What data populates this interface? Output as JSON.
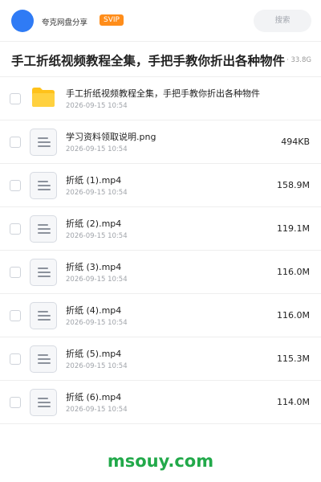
{
  "header": {
    "owner_name": "夸克网盘分享",
    "badge": "SVIP",
    "search_placeholder": "搜索"
  },
  "share": {
    "title": "手工折纸视频教程全集，手把手教你折出各种物件",
    "meta": "项 · 33.8G"
  },
  "files": [
    {
      "type": "folder",
      "name": "手工折纸视频教程全集，手把手教你折出各种物件",
      "date": "2026-09-15 10:54",
      "size": ""
    },
    {
      "type": "file",
      "name": "学习资料领取说明.png",
      "date": "2026-09-15 10:54",
      "size": "494KB"
    },
    {
      "type": "file",
      "name": "折纸 (1).mp4",
      "date": "2026-09-15 10:54",
      "size": "158.9M"
    },
    {
      "type": "file",
      "name": "折纸 (2).mp4",
      "date": "2026-09-15 10:54",
      "size": "119.1M"
    },
    {
      "type": "file",
      "name": "折纸 (3).mp4",
      "date": "2026-09-15 10:54",
      "size": "116.0M"
    },
    {
      "type": "file",
      "name": "折纸 (4).mp4",
      "date": "2026-09-15 10:54",
      "size": "116.0M"
    },
    {
      "type": "file",
      "name": "折纸 (5).mp4",
      "date": "2026-09-15 10:54",
      "size": "115.3M"
    },
    {
      "type": "file",
      "name": "折纸 (6).mp4",
      "date": "2026-09-15 10:54",
      "size": "114.0M"
    }
  ],
  "footer": {
    "brand": "msouy.com"
  },
  "colors": {
    "avatar": "#2f7bf5",
    "badge": "#ff8d1a",
    "folder": "#ffc21a",
    "brand": "#22a94a"
  },
  "icons": {
    "folder": "folder-icon",
    "file": "document-icon"
  }
}
